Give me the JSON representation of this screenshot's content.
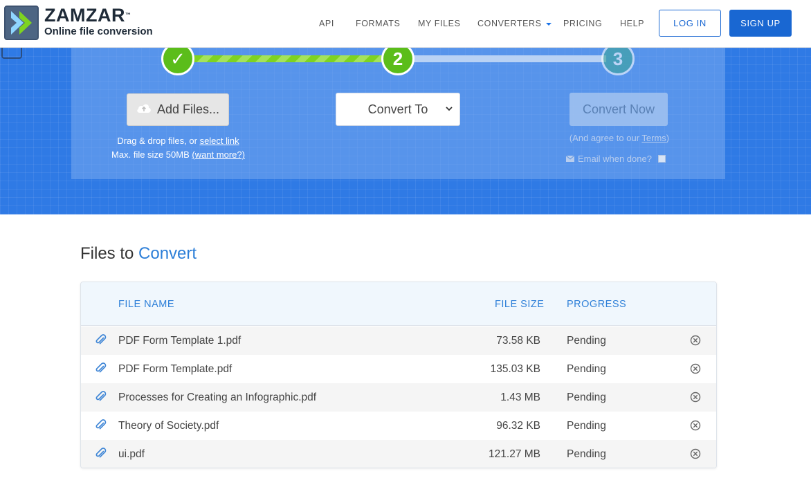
{
  "brand": {
    "name": "ZAMZAR",
    "tm": "™",
    "tagline": "Online file conversion"
  },
  "nav": {
    "items": [
      "API",
      "FORMATS",
      "MY FILES",
      "CONVERTERS",
      "PRICING",
      "HELP"
    ],
    "login": "LOG IN",
    "signup": "SIGN UP"
  },
  "steps": {
    "one": "✓",
    "two": "2",
    "three": "3"
  },
  "upload": {
    "add_files": "Add Files...",
    "drag_text": "Drag & drop files, or ",
    "select_link": "select link",
    "max_text": "Max. file size 50MB ",
    "want_more": "(want more?)"
  },
  "convert_to": {
    "selected": "Convert To"
  },
  "convert_now": {
    "label": "Convert Now",
    "agree_prefix": "(And agree to our ",
    "terms": "Terms",
    "agree_suffix": ")",
    "email_label": "Email when done?"
  },
  "files": {
    "title_a": "Files to ",
    "title_b": "Convert",
    "headers": {
      "name": "FILE NAME",
      "size": "FILE SIZE",
      "progress": "PROGRESS"
    },
    "rows": [
      {
        "name": "PDF Form Template 1.pdf",
        "size": "73.58 KB",
        "progress": "Pending"
      },
      {
        "name": "PDF Form Template.pdf",
        "size": "135.03 KB",
        "progress": "Pending"
      },
      {
        "name": "Processes for Creating an Infographic.pdf",
        "size": "1.43 MB",
        "progress": "Pending"
      },
      {
        "name": "Theory of Society.pdf",
        "size": "96.32 KB",
        "progress": "Pending"
      },
      {
        "name": "ui.pdf",
        "size": "121.27 MB",
        "progress": "Pending"
      }
    ]
  },
  "colors": {
    "accent": "#1967d2",
    "hero": "#2f7ae5",
    "step_done": "#5bbd1a",
    "link_blue": "#2d7fd8"
  }
}
